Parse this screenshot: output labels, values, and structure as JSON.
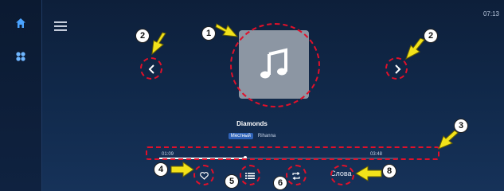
{
  "status": {
    "time": "07:13"
  },
  "sidebar": {
    "items": [
      {
        "icon": "home-icon"
      },
      {
        "icon": "apps-icon"
      }
    ]
  },
  "header": {
    "menu_icon": "menu-icon"
  },
  "player": {
    "title": "Diamonds",
    "badge": "Местный",
    "artist": "Rihanna",
    "elapsed": "01:09",
    "duration": "03:48",
    "progress_fraction": 0.36,
    "lyrics_label": "Слова"
  },
  "annotations": {
    "labels": [
      "1",
      "2",
      "2",
      "3",
      "4",
      "5",
      "6",
      "8"
    ]
  },
  "colors": {
    "annotation": "#e0102a",
    "arrow": "#f2e21a",
    "accent": "#2f63b8"
  }
}
